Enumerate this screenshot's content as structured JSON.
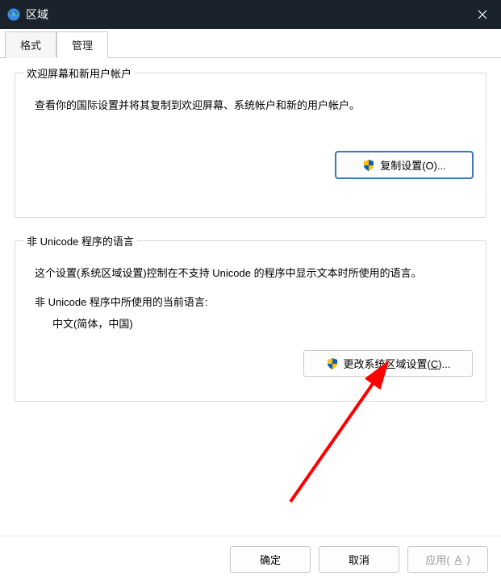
{
  "window": {
    "title": "区域"
  },
  "tabs": {
    "format": "格式",
    "admin": "管理"
  },
  "group_welcome": {
    "legend": "欢迎屏幕和新用户帐户",
    "desc": "查看你的国际设置并将其复制到欢迎屏幕、系统帐户和新的用户帐户。",
    "button": "复制设置(O)..."
  },
  "group_nonunicode": {
    "legend": "非 Unicode 程序的语言",
    "desc": "这个设置(系统区域设置)控制在不支持 Unicode 的程序中显示文本时所使用的语言。",
    "current_label": "非 Unicode 程序中所使用的当前语言:",
    "current_value": "中文(简体，中国)",
    "button_prefix": "更改系统区域设置(",
    "button_hotkey": "C",
    "button_suffix": ")..."
  },
  "footer": {
    "ok": "确定",
    "cancel": "取消",
    "apply_prefix": "应用(",
    "apply_hotkey": "A",
    "apply_suffix": ")"
  }
}
